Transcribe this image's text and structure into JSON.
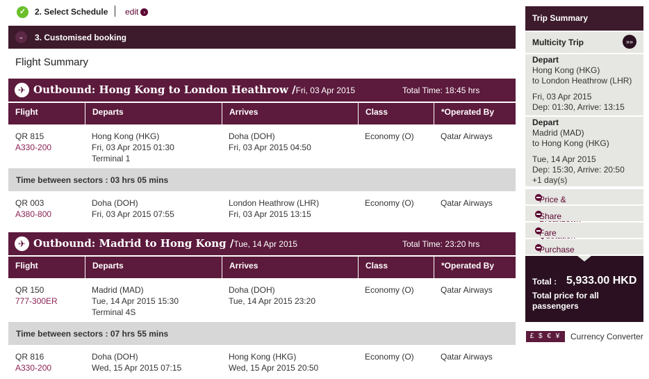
{
  "steps": {
    "step2_label": "2. Select Schedule",
    "edit_label": "edit",
    "step3_label": "3. Customised booking"
  },
  "flight_summary_title": "Flight Summary",
  "outbounds": [
    {
      "route": "Outbound: Hong Kong  to London Heathrow /",
      "date": "Fri, 03 Apr 2015",
      "total_time": "Total Time: 18:45 hrs",
      "columns": [
        "Flight",
        "Departs",
        "Arrives",
        "Class",
        "*Operated By"
      ],
      "legs": [
        {
          "flight": "QR 815",
          "aircraft": "A330-200",
          "dep_place": "Hong Kong (HKG)",
          "dep_time": "Fri, 03 Apr 2015 01:30",
          "dep_terminal": "Terminal 1",
          "arr_place": "Doha (DOH)",
          "arr_time": "Fri, 03 Apr 2015 04:50",
          "class": "Economy (O)",
          "operator": "Qatar Airways"
        },
        {
          "flight": "QR 003",
          "aircraft": "A380-800",
          "dep_place": "Doha (DOH)",
          "dep_time": "Fri, 03 Apr 2015 07:55",
          "dep_terminal": "",
          "arr_place": "London Heathrow (LHR)",
          "arr_time": "Fri, 03 Apr 2015 13:15",
          "class": "Economy (O)",
          "operator": "Qatar Airways"
        }
      ],
      "gap": "Time between sectors : 03 hrs 05 mins"
    },
    {
      "route": "Outbound: Madrid  to Hong Kong /",
      "date": "Tue, 14 Apr 2015",
      "total_time": "Total Time: 23:20 hrs",
      "columns": [
        "Flight",
        "Departs",
        "Arrives",
        "Class",
        "*Operated By"
      ],
      "legs": [
        {
          "flight": "QR 150",
          "aircraft": "777-300ER",
          "dep_place": "Madrid (MAD)",
          "dep_time": "Tue, 14 Apr 2015 15:30",
          "dep_terminal": "Terminal 4S",
          "arr_place": "Doha (DOH)",
          "arr_time": "Tue, 14 Apr 2015 23:20",
          "class": "Economy (O)",
          "operator": "Qatar Airways"
        },
        {
          "flight": "QR 816",
          "aircraft": "A330-200",
          "dep_place": "Doha (DOH)",
          "dep_time": "Wed, 15 Apr 2015 07:15",
          "dep_terminal": "",
          "arr_place": "Hong Kong (HKG)",
          "arr_time": "Wed, 15 Apr 2015 20:50",
          "class": "Economy (O)",
          "operator": "Qatar Airways"
        }
      ],
      "gap": "Time between sectors : 07 hrs 55 mins"
    }
  ],
  "trip_summary": {
    "title": "Trip Summary",
    "trip_type": "Multicity Trip",
    "departures": [
      {
        "label": "Depart",
        "from": "Hong Kong (HKG)",
        "to": "to London Heathrow (LHR)",
        "date": "Fri, 03 Apr 2015",
        "times": "Dep: 01:30, Arrive: 13:15",
        "extra": ""
      },
      {
        "label": "Depart",
        "from": "Madrid (MAD)",
        "to": "to Hong Kong (HKG)",
        "date": "Tue, 14 Apr 2015",
        "times": "Dep: 15:30, Arrive: 20:50",
        "extra": "+1 day(s)"
      }
    ],
    "links": [
      "Price & Tax Breakdown",
      "Share this Quotation",
      "Fare Rules",
      "Purchase Conditions"
    ],
    "total_label": "Total :",
    "total_value": "5,933.00 HKD",
    "total_note": "Total price for all passengers",
    "currency_icons": "£ $ € ¥",
    "currency_converter": "Currency Converter"
  },
  "colors": {
    "plum": "#5c1a3c",
    "dark_plum": "#3d1a2c",
    "check_green": "#6abf2b",
    "gap_gray": "#d7d7d7",
    "side_gray": "#e6e6e2"
  }
}
